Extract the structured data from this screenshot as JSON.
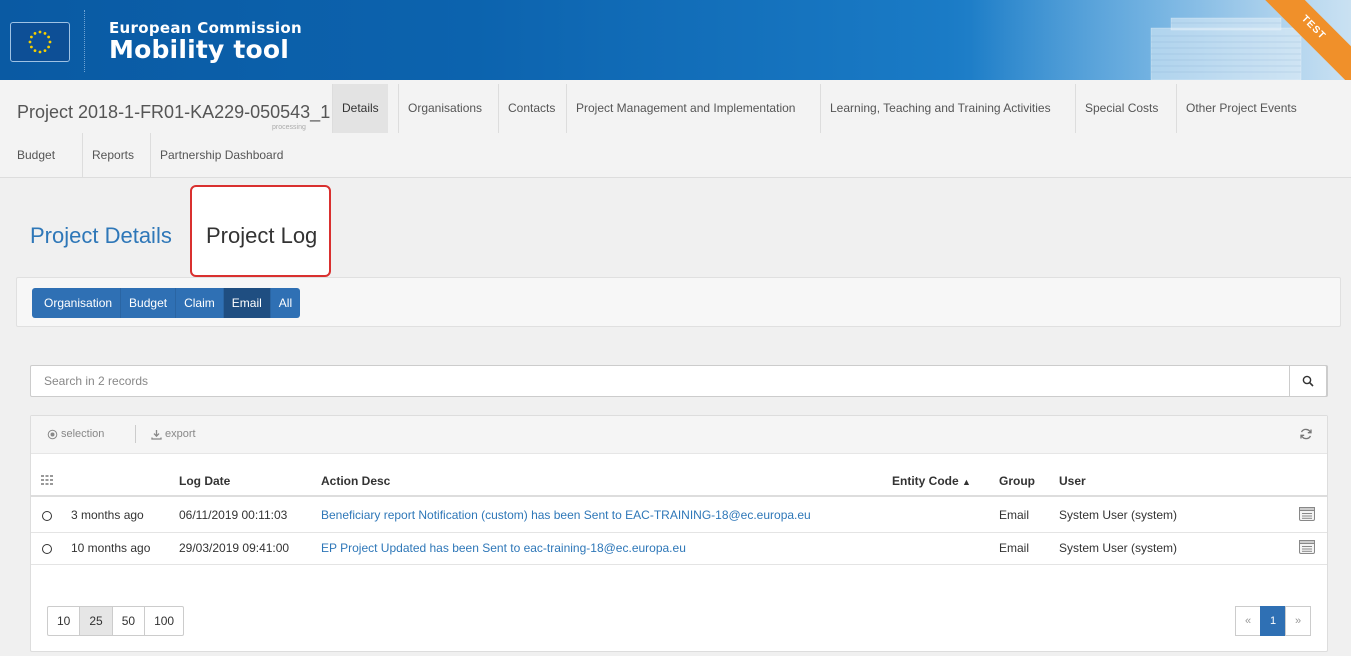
{
  "header": {
    "org": "European Commission",
    "app": "Mobility tool",
    "env_badge": "TEST",
    "flag_icon": "eu-flag-icon"
  },
  "navbar": {
    "project_id": "Project 2018-1-FR01-KA229-050543_1",
    "project_status": "processing",
    "items": [
      {
        "label": "Details"
      },
      {
        "label": "Organisations"
      },
      {
        "label": "Contacts"
      },
      {
        "label": "Project Management and Implementation"
      },
      {
        "label": "Learning, Teaching and Training Activities"
      },
      {
        "label": "Special Costs"
      },
      {
        "label": "Other Project Events"
      },
      {
        "label": "Budget"
      },
      {
        "label": "Reports"
      },
      {
        "label": "Partnership Dashboard"
      }
    ],
    "active": "Details"
  },
  "page_tabs": {
    "details": "Project Details",
    "log": "Project Log",
    "active": "Project Log"
  },
  "filters": {
    "buttons": [
      "Organisation",
      "Budget",
      "Claim",
      "Email",
      "All"
    ],
    "active": "Email"
  },
  "search": {
    "placeholder": "Search in 2 records",
    "icon": "search-icon"
  },
  "toolbar": {
    "selection": "selection",
    "export": "export"
  },
  "table": {
    "columns": {
      "log_date": "Log Date",
      "action_desc": "Action Desc",
      "entity_code": "Entity Code",
      "group": "Group",
      "user": "User"
    },
    "sorted_column": "Entity Code",
    "sort_direction": "ascending",
    "rows": [
      {
        "relative": "3 months ago",
        "log_date": "06/11/2019 00:11:03",
        "action_desc": "Beneficiary report Notification (custom) has been Sent to EAC-TRAINING-18@ec.europa.eu",
        "entity_code": "",
        "group": "Email",
        "user": "System User (system)"
      },
      {
        "relative": "10 months ago",
        "log_date": "29/03/2019 09:41:00",
        "action_desc": "EP Project Updated has been Sent to eac-training-18@ec.europa.eu",
        "entity_code": "",
        "group": "Email",
        "user": "System User (system)"
      }
    ]
  },
  "pagination": {
    "page_sizes": [
      "10",
      "25",
      "50",
      "100"
    ],
    "active_size": "25",
    "prev": "«",
    "current_page": "1",
    "next": "»"
  },
  "colors": {
    "brand_blue": "#0b5fa8",
    "button_blue": "#2f70b4",
    "link_blue": "#2e77b8",
    "highlight_red": "#d9302f",
    "test_orange": "#f0902a"
  }
}
